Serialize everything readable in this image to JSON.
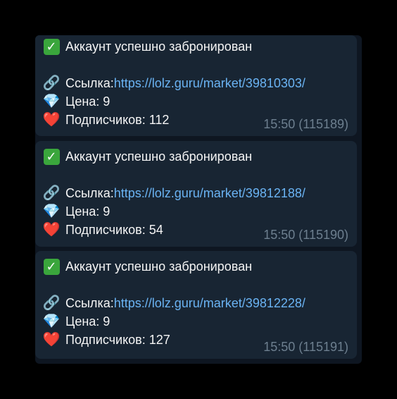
{
  "messages": [
    {
      "status_icon": "check-mark-icon",
      "title": "Аккаунт успешно забронирован",
      "link_label": "Ссылка: ",
      "link_url": "https://lolz.guru/market/39810303/",
      "price_label": "Цена: 9",
      "subs_label": "Подписчиков: 112",
      "time": "15:50 (115189)"
    },
    {
      "status_icon": "check-mark-icon",
      "title": "Аккаунт успешно забронирован",
      "link_label": "Ссылка: ",
      "link_url": "https://lolz.guru/market/39812188/",
      "price_label": "Цена: 9",
      "subs_label": "Подписчиков: 54",
      "time": "15:50 (115190)"
    },
    {
      "status_icon": "check-mark-icon",
      "title": "Аккаунт успешно забронирован",
      "link_label": "Ссылка: ",
      "link_url": "https://lolz.guru/market/39812228/",
      "price_label": "Цена: 9",
      "subs_label": "Подписчиков: 127",
      "time": "15:50 (115191)"
    }
  ],
  "colors": {
    "bubble": "#182533",
    "link": "#6ab3f3",
    "meta": "#6d7f8f"
  }
}
